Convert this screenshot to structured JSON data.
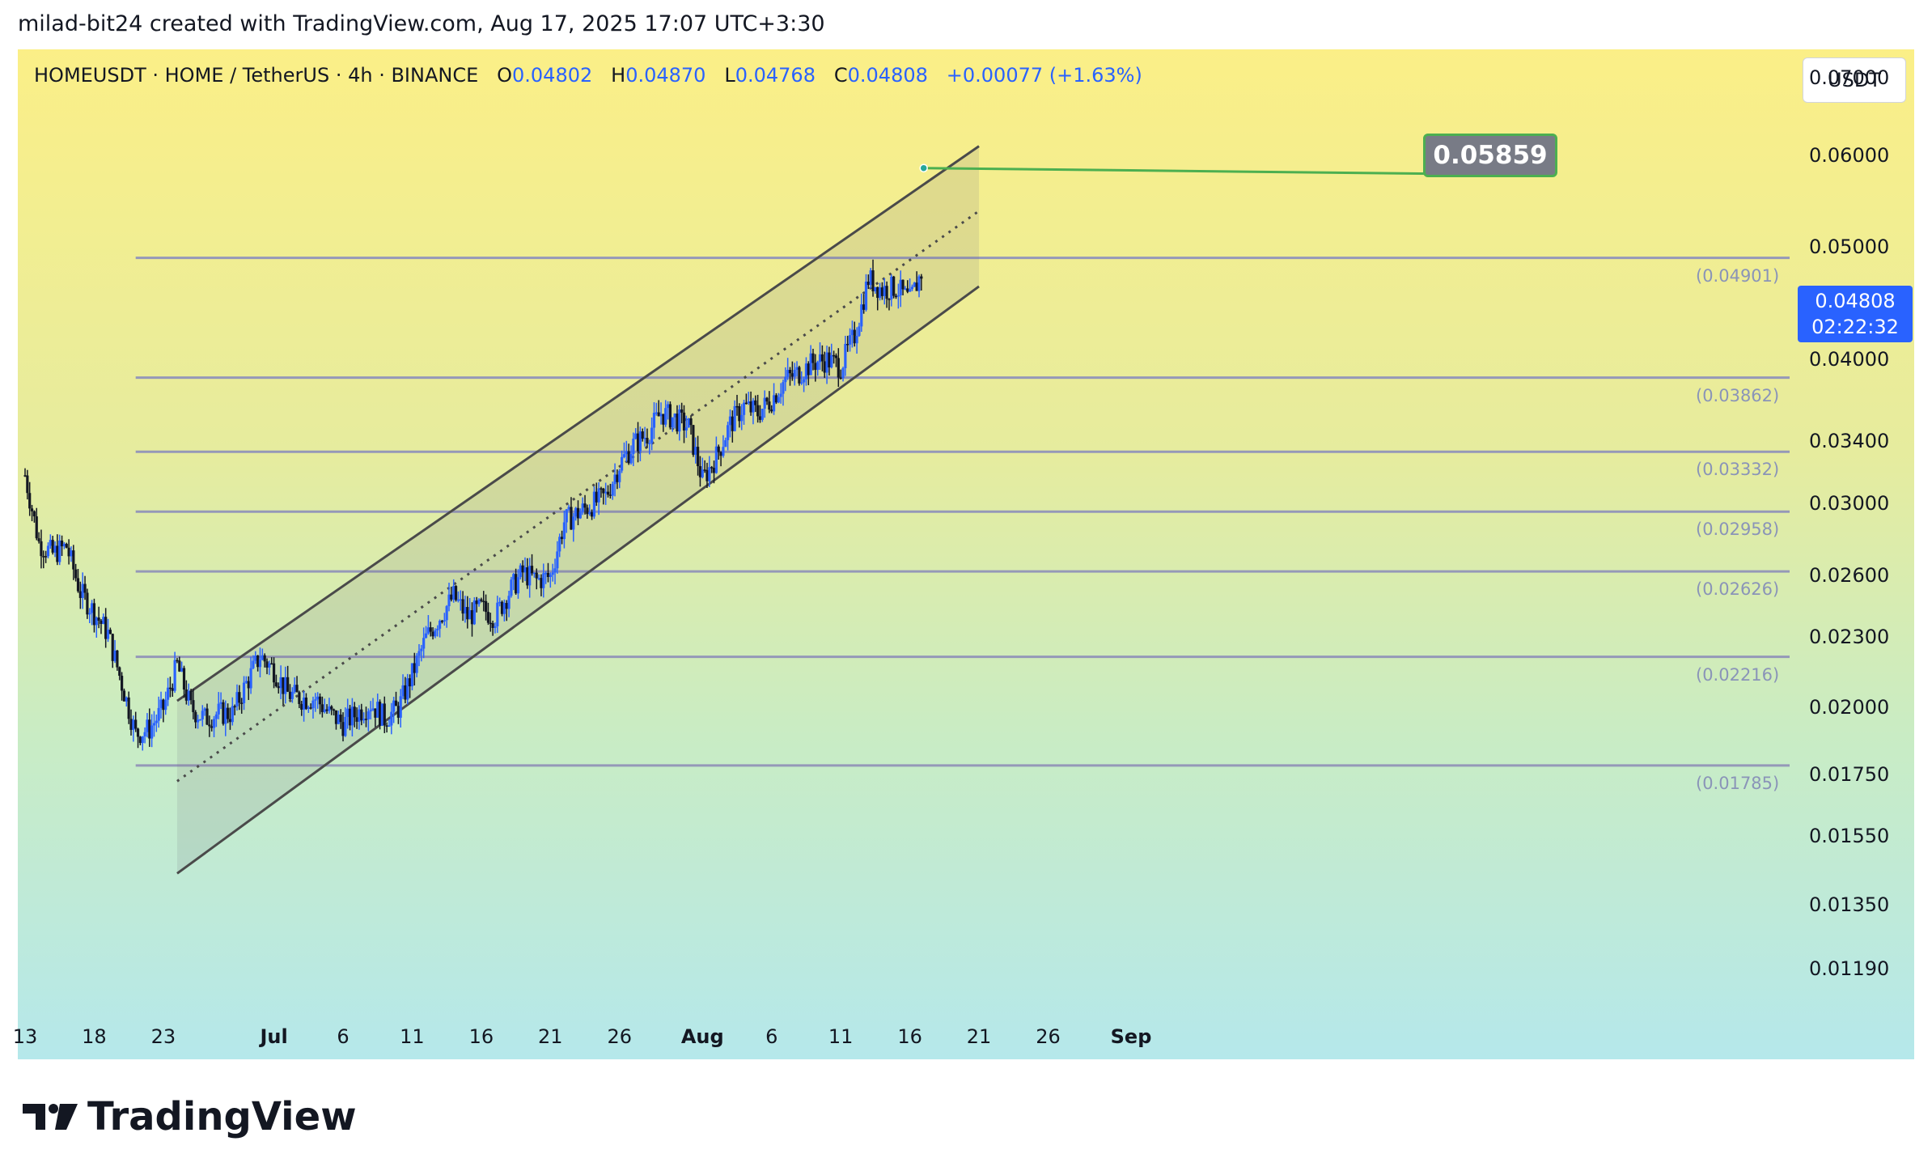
{
  "header": "milad-bit24 created with TradingView.com, Aug 17, 2025 17:07 UTC+3:30",
  "legend": {
    "symbol": "HOMEUSDT · HOME / TetherUS · 4h · BINANCE",
    "o_label": "O",
    "o": "0.04802",
    "h_label": "H",
    "h": "0.04870",
    "l_label": "L",
    "l": "0.04768",
    "c_label": "C",
    "c": "0.04808",
    "change": "+0.00077 (+1.63%)"
  },
  "unit": "USDT",
  "last_price": "0.04808",
  "countdown": "02:22:32",
  "target_label": "0.05859",
  "brand": "TradingView",
  "colors": {
    "up": "#2962ff",
    "down": "#131722",
    "channel": "#4a4a4a",
    "levels": "#9598b8",
    "target_border": "#4caf50"
  },
  "chart_data": {
    "type": "candlestick",
    "symbol": "HOMEUSDT",
    "interval": "4h",
    "exchange": "BINANCE",
    "y_scale": "log",
    "ylim": [
      0.0111,
      0.0742
    ],
    "y_ticks": [
      "0.07000",
      "0.06000",
      "0.05000",
      "0.04000",
      "0.03400",
      "0.03000",
      "0.02600",
      "0.02300",
      "0.02000",
      "0.01750",
      "0.01550",
      "0.01350",
      "0.01190"
    ],
    "x_ticks": [
      "13",
      "18",
      "23",
      "Jul",
      "6",
      "11",
      "16",
      "21",
      "26",
      "Aug",
      "6",
      "11",
      "16",
      "21",
      "26",
      "Sep"
    ],
    "x_range": [
      "2025-06-13",
      "2025-09-01"
    ],
    "levels": [
      "0.04901",
      "0.03862",
      "0.03332",
      "0.02958",
      "0.02626",
      "0.02216",
      "0.01785"
    ],
    "channel": {
      "start": "2025-06-24",
      "end": "2025-08-21",
      "upper": [
        0.0203,
        0.0612
      ],
      "middle": [
        0.0173,
        0.0538
      ],
      "lower": [
        0.0144,
        0.0463
      ]
    },
    "target": {
      "date": "2025-08-17",
      "value": 0.05859
    },
    "close_path": [
      [
        "2025-06-13",
        0.0318
      ],
      [
        "2025-06-14",
        0.0278
      ],
      [
        "2025-06-15",
        0.0272
      ],
      [
        "2025-06-16",
        0.0276
      ],
      [
        "2025-06-17",
        0.0252
      ],
      [
        "2025-06-18",
        0.0242
      ],
      [
        "2025-06-19",
        0.0232
      ],
      [
        "2025-06-20",
        0.021
      ],
      [
        "2025-06-21",
        0.019
      ],
      [
        "2025-06-22",
        0.0192
      ],
      [
        "2025-06-23",
        0.02
      ],
      [
        "2025-06-24",
        0.0218
      ],
      [
        "2025-06-25",
        0.02
      ],
      [
        "2025-06-26",
        0.0196
      ],
      [
        "2025-06-27",
        0.0198
      ],
      [
        "2025-06-28",
        0.0198
      ],
      [
        "2025-06-29",
        0.021
      ],
      [
        "2025-06-30",
        0.0222
      ],
      [
        "2025-07-01",
        0.0216
      ],
      [
        "2025-07-02",
        0.0206
      ],
      [
        "2025-07-03",
        0.0204
      ],
      [
        "2025-07-04",
        0.0204
      ],
      [
        "2025-07-05",
        0.0198
      ],
      [
        "2025-07-06",
        0.0194
      ],
      [
        "2025-07-07",
        0.0198
      ],
      [
        "2025-07-08",
        0.0202
      ],
      [
        "2025-07-09",
        0.0196
      ],
      [
        "2025-07-10",
        0.02
      ],
      [
        "2025-07-11",
        0.0214
      ],
      [
        "2025-07-12",
        0.023
      ],
      [
        "2025-07-13",
        0.024
      ],
      [
        "2025-07-14",
        0.025
      ],
      [
        "2025-07-15",
        0.024
      ],
      [
        "2025-07-16",
        0.0244
      ],
      [
        "2025-07-17",
        0.024
      ],
      [
        "2025-07-18",
        0.0252
      ],
      [
        "2025-07-19",
        0.0262
      ],
      [
        "2025-07-20",
        0.0258
      ],
      [
        "2025-07-21",
        0.026
      ],
      [
        "2025-07-22",
        0.029
      ],
      [
        "2025-07-23",
        0.0295
      ],
      [
        "2025-07-24",
        0.03
      ],
      [
        "2025-07-25",
        0.0305
      ],
      [
        "2025-07-26",
        0.0325
      ],
      [
        "2025-07-27",
        0.0338
      ],
      [
        "2025-07-28",
        0.0345
      ],
      [
        "2025-07-29",
        0.036
      ],
      [
        "2025-07-30",
        0.0356
      ],
      [
        "2025-07-31",
        0.035
      ],
      [
        "2025-08-01",
        0.0315
      ],
      [
        "2025-08-02",
        0.033
      ],
      [
        "2025-08-03",
        0.0352
      ],
      [
        "2025-08-04",
        0.0365
      ],
      [
        "2025-08-05",
        0.036
      ],
      [
        "2025-08-06",
        0.037
      ],
      [
        "2025-08-07",
        0.0385
      ],
      [
        "2025-08-08",
        0.039
      ],
      [
        "2025-08-09",
        0.0398
      ],
      [
        "2025-08-10",
        0.04
      ],
      [
        "2025-08-11",
        0.0395
      ],
      [
        "2025-08-12",
        0.042
      ],
      [
        "2025-08-13",
        0.047
      ],
      [
        "2025-08-14",
        0.046
      ],
      [
        "2025-08-15",
        0.0462
      ],
      [
        "2025-08-16",
        0.045
      ],
      [
        "2025-08-17",
        0.0481
      ]
    ]
  }
}
